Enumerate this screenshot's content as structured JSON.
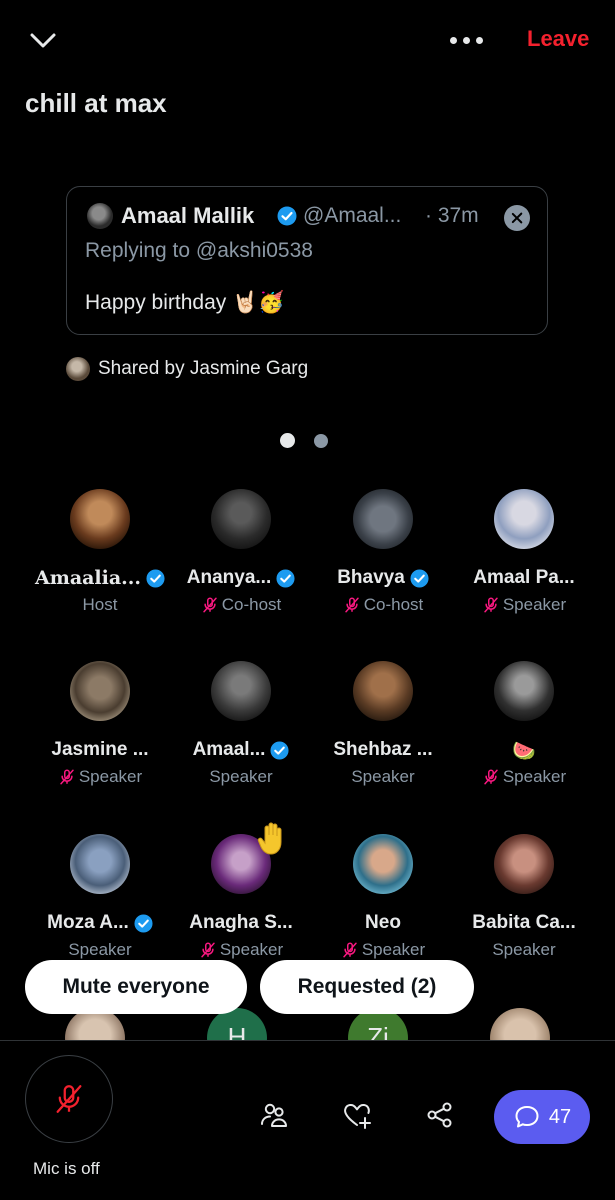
{
  "header": {
    "leave_label": "Leave",
    "title": "chill at max"
  },
  "tweet": {
    "author": "Amaal Mallik",
    "handle": "@Amaal...",
    "time": "· 37m",
    "replying_to": "Replying to @akshi0538",
    "text": "Happy birthday 🤘🏻🥳"
  },
  "shared_by": "Shared by Jasmine Garg",
  "speakers": [
    {
      "name": "Amaalia...",
      "role": "Host",
      "verified": true,
      "muted": false,
      "serif": true
    },
    {
      "name": "Ananya...",
      "role": "Co-host",
      "verified": true,
      "muted": true
    },
    {
      "name": "Bhavya",
      "role": "Co-host",
      "verified": true,
      "muted": true
    },
    {
      "name": "Amaal Pa...",
      "role": "Speaker",
      "verified": false,
      "muted": true
    },
    {
      "name": "Jasmine ...",
      "role": "Speaker",
      "verified": false,
      "muted": true
    },
    {
      "name": "Amaal...",
      "role": "Speaker",
      "verified": true,
      "muted": false
    },
    {
      "name": "Shehbaz ...",
      "role": "Speaker",
      "verified": false,
      "muted": false
    },
    {
      "name": "🍉",
      "role": "Speaker",
      "verified": false,
      "muted": true
    },
    {
      "name": "Moza A...",
      "role": "Speaker",
      "verified": true,
      "muted": false
    },
    {
      "name": "Anagha S...",
      "role": "Speaker",
      "verified": false,
      "muted": true,
      "hand_raised": true
    },
    {
      "name": "Neo",
      "role": "Speaker",
      "verified": false,
      "muted": true
    },
    {
      "name": "Babita Ca...",
      "role": "Speaker",
      "verified": false,
      "muted": false
    }
  ],
  "partial_avatars": [
    "",
    "H",
    "Zi",
    ""
  ],
  "actions": {
    "mute_everyone": "Mute everyone",
    "requested": "Requested (2)"
  },
  "bottom": {
    "mic_label": "Mic is off",
    "chat_count": "47"
  },
  "colors": {
    "accent": "#1d9bf0",
    "leave": "#f4212e",
    "chat": "#5b5cf0",
    "muted_mic": "#f91880"
  }
}
